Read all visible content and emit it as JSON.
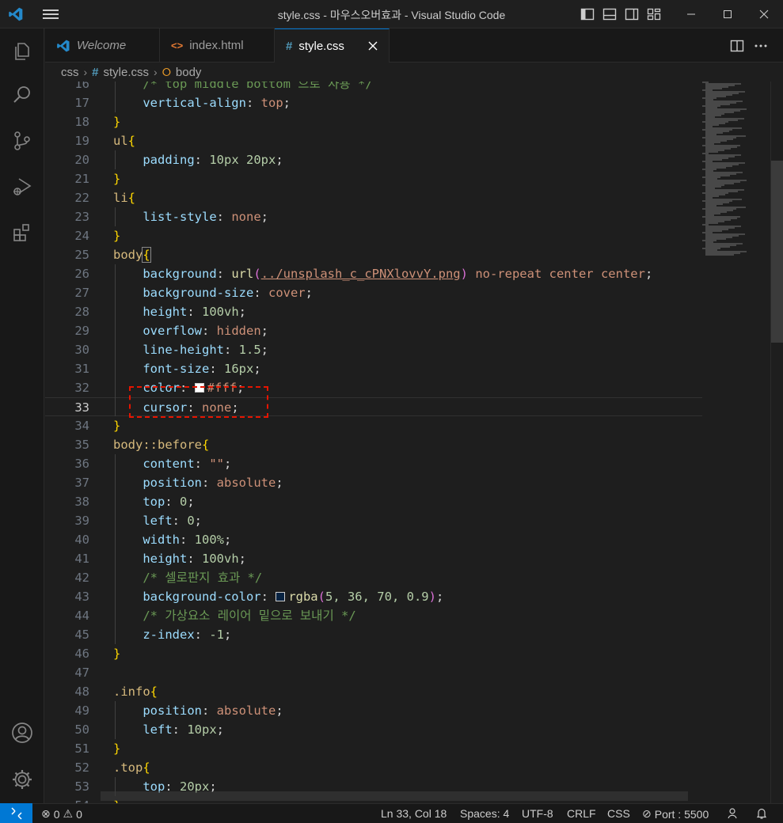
{
  "window": {
    "title": "style.css - 마우스오버효과 - Visual Studio Code"
  },
  "tabs": [
    {
      "label": "Welcome",
      "icon": "vscode-icon",
      "active": false
    },
    {
      "label": "index.html",
      "icon": "html-icon",
      "active": false
    },
    {
      "label": "style.css",
      "icon": "css-hash-icon",
      "active": true
    }
  ],
  "breadcrumb": {
    "folder": "css",
    "file": "style.css",
    "symbol": "body"
  },
  "colors": {
    "accent": "#0078d4",
    "highlight_box": "#e51400",
    "editor_bg": "#1e1e1e"
  },
  "editor": {
    "lines": [
      {
        "n": "16",
        "text": "/* top middle bottom 으로 사용 */"
      },
      {
        "n": "17",
        "text": "vertical-align: top;"
      },
      {
        "n": "18",
        "text": "}"
      },
      {
        "n": "19",
        "text": "ul{"
      },
      {
        "n": "20",
        "text": "padding: 10px 20px;"
      },
      {
        "n": "21",
        "text": "}"
      },
      {
        "n": "22",
        "text": "li{"
      },
      {
        "n": "23",
        "text": "list-style: none;"
      },
      {
        "n": "24",
        "text": "}"
      },
      {
        "n": "25",
        "text": "body{"
      },
      {
        "n": "26",
        "text": "background: url(../unsplash_c_cPNXlovvY.png) no-repeat center center;"
      },
      {
        "n": "27",
        "text": "background-size: cover;"
      },
      {
        "n": "28",
        "text": "height: 100vh;"
      },
      {
        "n": "29",
        "text": "overflow: hidden;"
      },
      {
        "n": "30",
        "text": "line-height: 1.5;"
      },
      {
        "n": "31",
        "text": "font-size: 16px;"
      },
      {
        "n": "32",
        "text": "color: #fff;"
      },
      {
        "n": "33",
        "text": "cursor: none;"
      },
      {
        "n": "34",
        "text": "}"
      },
      {
        "n": "35",
        "text": "body::before{"
      },
      {
        "n": "36",
        "text": "content: \"\";"
      },
      {
        "n": "37",
        "text": "position: absolute;"
      },
      {
        "n": "38",
        "text": "top: 0;"
      },
      {
        "n": "39",
        "text": "left: 0;"
      },
      {
        "n": "40",
        "text": "width: 100%;"
      },
      {
        "n": "41",
        "text": "height: 100vh;"
      },
      {
        "n": "42",
        "text": "/* 셀로판지 효과 */"
      },
      {
        "n": "43",
        "text": "background-color: rgba(5, 36, 70, 0.9);"
      },
      {
        "n": "44",
        "text": "/* 가상요소 레이어 밑으로 보내기 */"
      },
      {
        "n": "45",
        "text": "z-index: -1;"
      },
      {
        "n": "46",
        "text": "}"
      },
      {
        "n": "47",
        "text": ""
      },
      {
        "n": "48",
        "text": ".info{"
      },
      {
        "n": "49",
        "text": "position: absolute;"
      },
      {
        "n": "50",
        "text": "left: 10px;"
      },
      {
        "n": "51",
        "text": "}"
      },
      {
        "n": "52",
        "text": ".top{"
      },
      {
        "n": "53",
        "text": "top: 20px;"
      },
      {
        "n": "54",
        "text": "}"
      }
    ]
  },
  "statusbar": {
    "errors": "0",
    "warnings": "0",
    "cursor_pos": "Ln 33, Col 18",
    "spaces": "Spaces: 4",
    "encoding": "UTF-8",
    "eol": "CRLF",
    "language": "CSS",
    "port": "Port : 5500"
  }
}
